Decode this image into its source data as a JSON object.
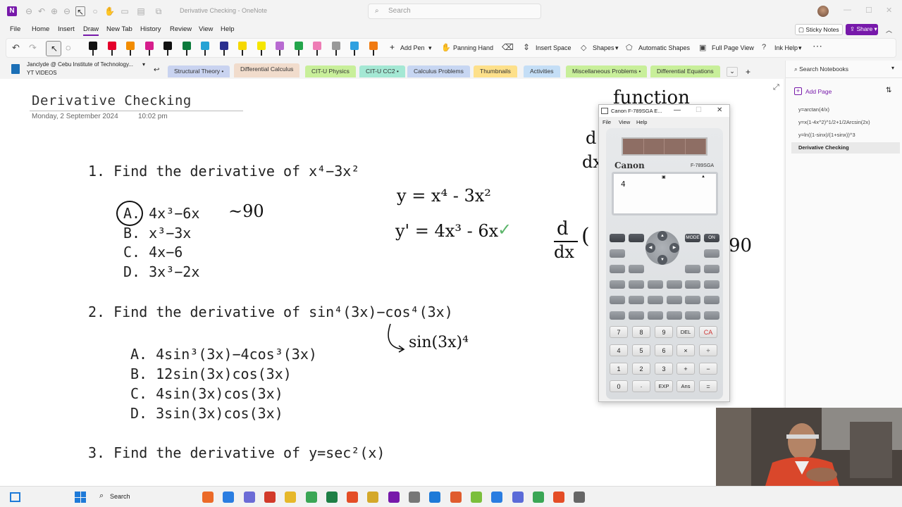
{
  "window": {
    "title": "Derivative Checking - OneNote",
    "search_placeholder": "Search"
  },
  "ribbon": {
    "tabs": [
      "File",
      "Home",
      "Insert",
      "Draw",
      "New Tab",
      "History",
      "Review",
      "View",
      "Help"
    ],
    "active_tab": "Draw",
    "sticky_notes": "Sticky Notes",
    "share": "Share"
  },
  "toolbar": {
    "add_pen": "Add Pen",
    "panning_hand": "Panning Hand",
    "insert_space": "Insert Space",
    "shapes": "Shapes",
    "automatic_shapes": "Automatic Shapes",
    "full_page_view": "Full Page View",
    "ink_help": "Ink Help",
    "pen_colors": [
      "#111111",
      "#e4002b",
      "#f28c00",
      "#d61e8c",
      "#111111",
      "#0b7a3b",
      "#25a3d5",
      "#2b2f8f",
      "#f5d800",
      "#f5e600",
      "#b86ad1",
      "#23a54b",
      "#ee7db5",
      "#999999",
      "#2fa1e0",
      "#f07a10"
    ]
  },
  "notebook": {
    "name": "Janclyde @ Cebu Institute of Technology...",
    "subtitle": "YT VIDEOS"
  },
  "sections": [
    {
      "label": "Structural Theory •",
      "color": "#c9d3f0"
    },
    {
      "label": "Differential Calculus",
      "color": "#f1dccc"
    },
    {
      "label": "CIT-U Physics",
      "color": "#c8ef9a"
    },
    {
      "label": "CIT-U CC2 •",
      "color": "#a4e8d4"
    },
    {
      "label": "Calculus Problems",
      "color": "#c7d6f2"
    },
    {
      "label": "Thumbnails",
      "color": "#fde08a"
    },
    {
      "label": "Activities",
      "color": "#c4def6"
    },
    {
      "label": "Miscellaneous Problems •",
      "color": "#c8ef9a"
    },
    {
      "label": "Differential Equations",
      "color": "#c8ef9a"
    }
  ],
  "sidebar": {
    "search": "Search Notebooks",
    "add_page": "Add Page",
    "pages": [
      "y=arctan(4/x)",
      "y=x(1-4x^2)^1/2+1/2Arcsin(2x)",
      "y=ln((1-sinx)/(1+sinx))^3",
      "Derivative Checking"
    ],
    "active_page": "Derivative Checking"
  },
  "page": {
    "title": "Derivative Checking",
    "date": "Monday, 2 September 2024",
    "time": "10:02 pm"
  },
  "questions": {
    "q1": {
      "text": "1. Find the derivative of x⁴−3x²",
      "options": [
        "A.  4x³−6x",
        "B.  x³−3x",
        "C.  4x−6",
        "D.  3x³−2x"
      ]
    },
    "q2": {
      "text": "2. Find the derivative of sin⁴(3x)−cos⁴(3x)",
      "options": [
        "A.  4sin³(3x)−4cos³(3x)",
        "B.  12sin(3x)cos(3x)",
        "C.  4sin(3x)cos(3x)",
        "D.  3sin(3x)cos(3x)"
      ]
    },
    "q3": {
      "text": "3. Find the derivative of y=sec²(x)"
    }
  },
  "handwriting": {
    "score_q1": "~90",
    "work_line1": "y = x⁴ - 3x²",
    "work_line2": "y' = 4x³ - 6x",
    "check": "✓",
    "q2_note": "sin(3x)⁴",
    "function_label": "function",
    "ddx": "d",
    "dx": "dx",
    "paren": "(",
    "right_90": "90"
  },
  "calculator": {
    "title": "Canon F-789SGA E...",
    "menus": [
      "File",
      "View",
      "Help"
    ],
    "brand": "Canon",
    "model": "F-789SGA",
    "display": "4",
    "keys_row1": [
      "7",
      "8",
      "9",
      "DEL",
      "CA"
    ],
    "keys_row2": [
      "4",
      "5",
      "6",
      "×",
      "÷"
    ],
    "keys_row3": [
      "1",
      "2",
      "3",
      "+",
      "−"
    ],
    "keys_row4": [
      "0",
      "·",
      "EXP",
      "Ans",
      "="
    ],
    "top_keys": [
      "MODE",
      "ON"
    ]
  },
  "taskbar": {
    "search": "Search"
  }
}
